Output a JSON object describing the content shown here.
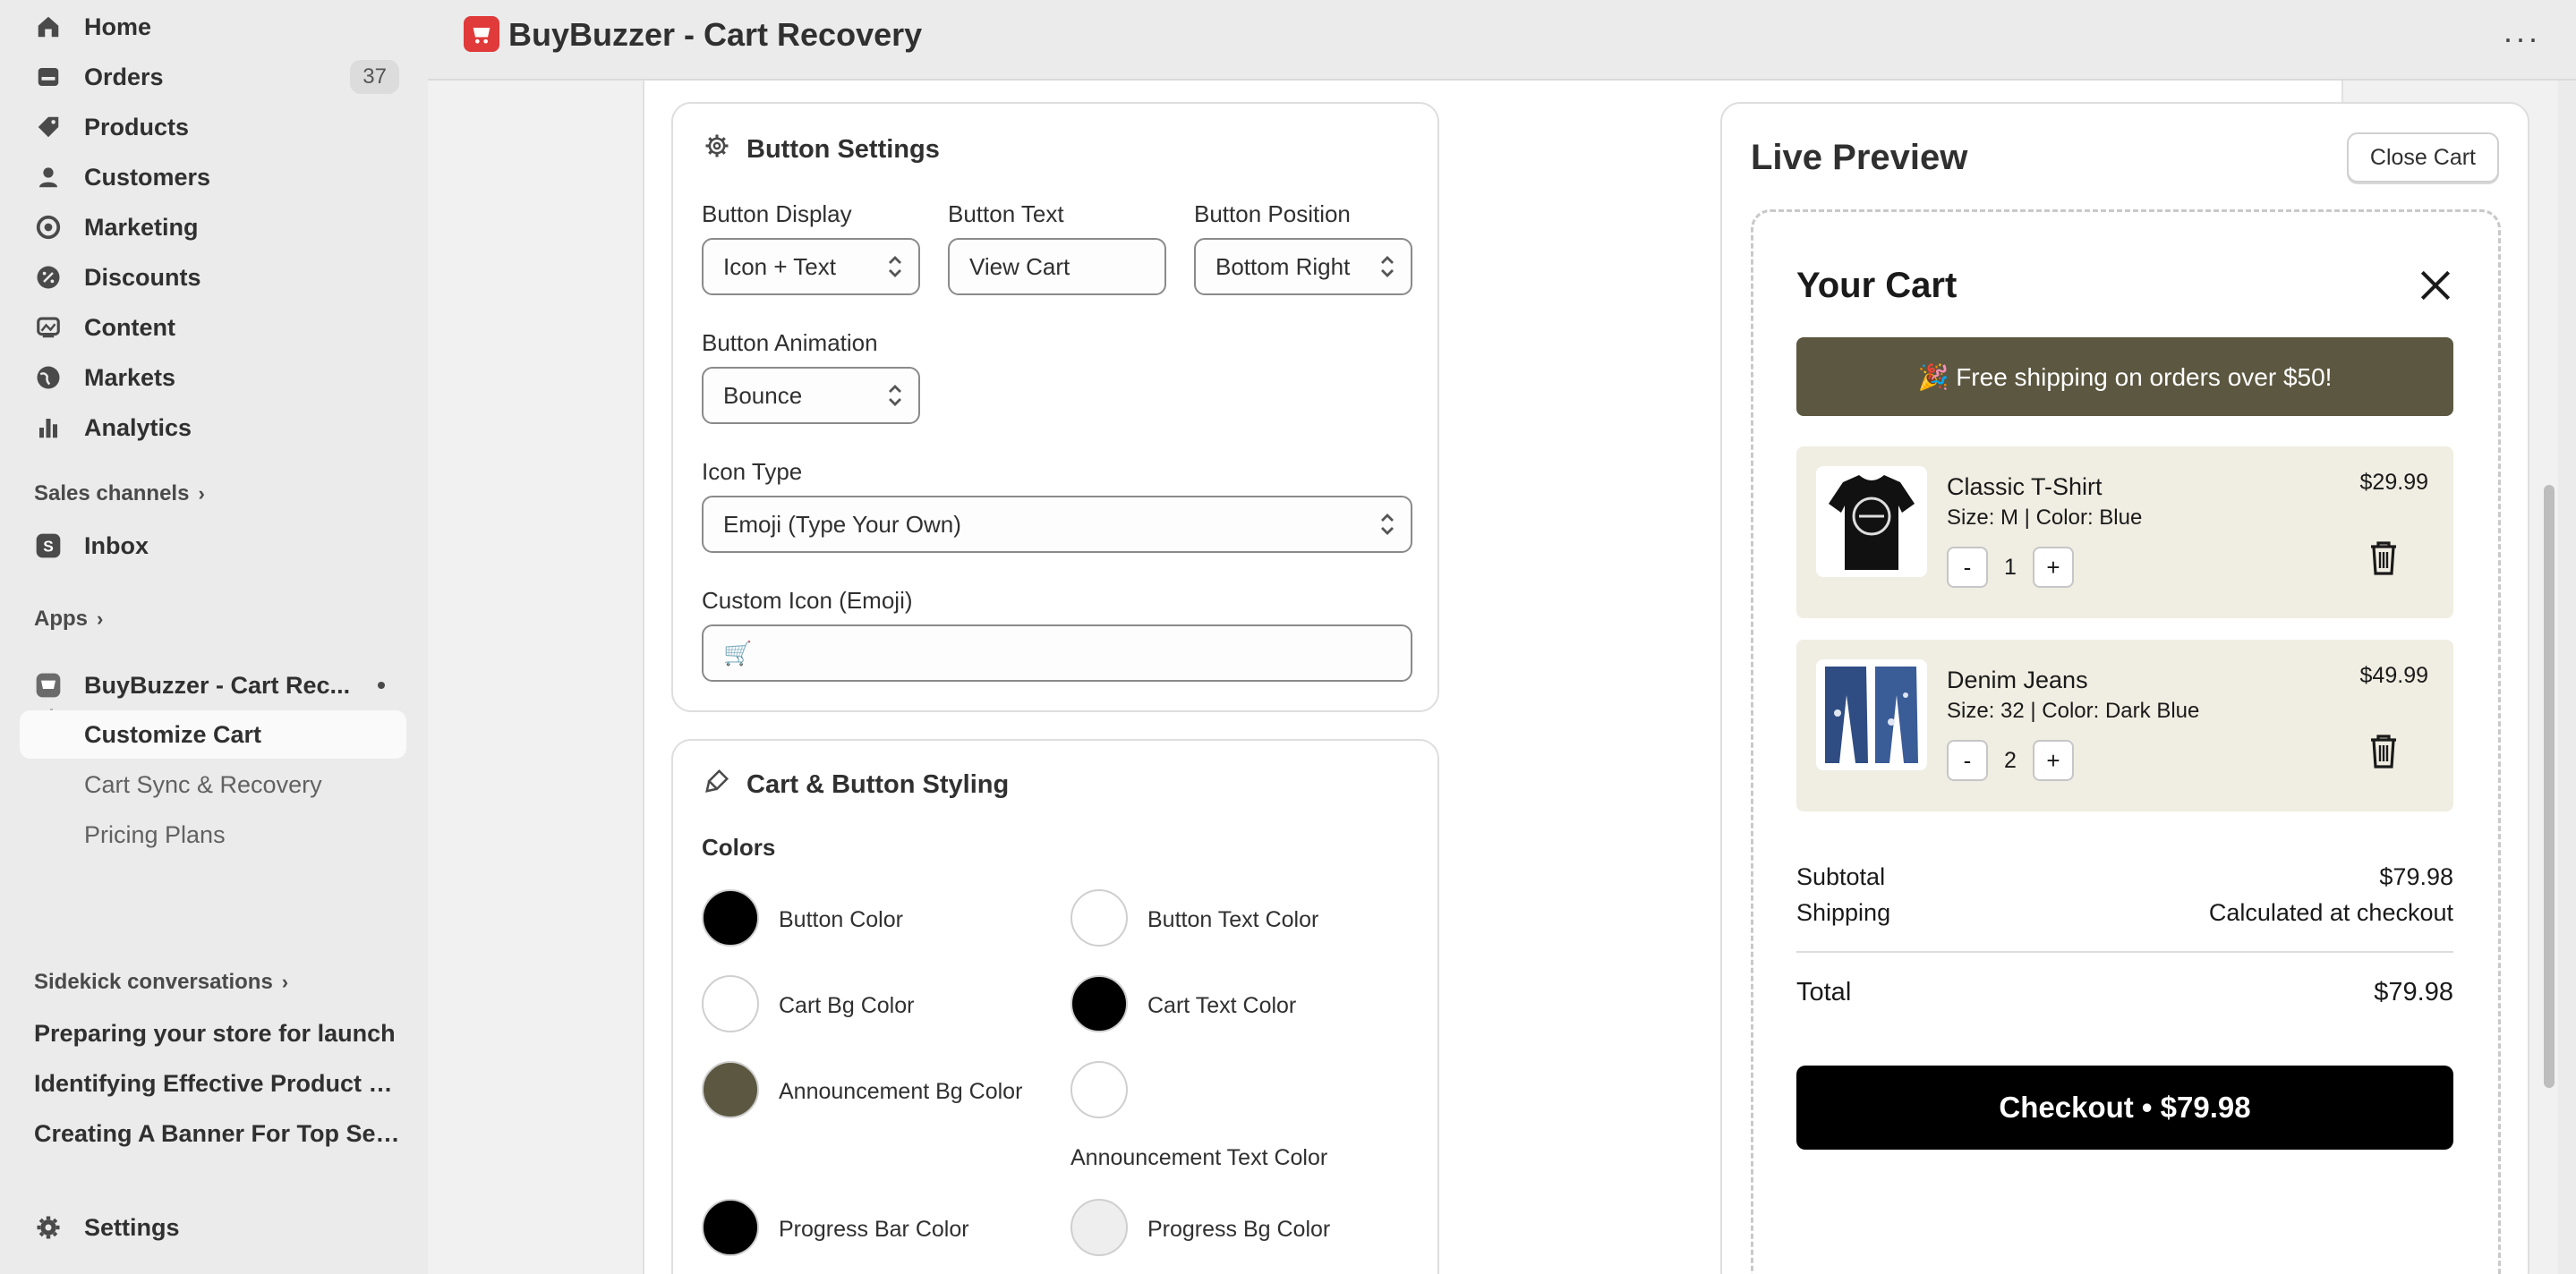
{
  "sidebar": {
    "nav": [
      {
        "label": "Home",
        "icon": "home-icon"
      },
      {
        "label": "Orders",
        "icon": "orders-icon",
        "badge": "37"
      },
      {
        "label": "Products",
        "icon": "tag-icon"
      },
      {
        "label": "Customers",
        "icon": "person-icon"
      },
      {
        "label": "Marketing",
        "icon": "target-icon"
      },
      {
        "label": "Discounts",
        "icon": "discount-icon"
      },
      {
        "label": "Content",
        "icon": "content-icon"
      },
      {
        "label": "Markets",
        "icon": "globe-icon"
      },
      {
        "label": "Analytics",
        "icon": "chart-icon"
      }
    ],
    "sales_channels": "Sales channels",
    "inbox": "Inbox",
    "apps": "Apps",
    "app_name": "BuyBuzzer - Cart Rec...",
    "sub_items": [
      "Customize Cart",
      "Cart Sync & Recovery",
      "Pricing Plans"
    ],
    "sidekick": "Sidekick conversations",
    "conversations": [
      "Preparing your store for launch",
      "Identifying Effective Product B...",
      "Creating A Banner For Top Sell..."
    ],
    "settings": "Settings"
  },
  "topbar": {
    "title": "BuyBuzzer - Cart Recovery",
    "more": "···"
  },
  "button_settings": {
    "title": "Button Settings",
    "display_label": "Button Display",
    "display_value": "Icon + Text",
    "text_label": "Button Text",
    "text_value": "View Cart",
    "position_label": "Button Position",
    "position_value": "Bottom Right",
    "animation_label": "Button Animation",
    "animation_value": "Bounce",
    "icon_type_label": "Icon Type",
    "icon_type_value": "Emoji (Type Your Own)",
    "custom_icon_label": "Custom Icon (Emoji)",
    "custom_icon_value": "🛒"
  },
  "styling": {
    "title": "Cart & Button Styling",
    "colors_label": "Colors",
    "colors": [
      {
        "label": "Button Color",
        "color": "#000000"
      },
      {
        "label": "Button Text Color",
        "color": "#ffffff"
      },
      {
        "label": "Cart Bg Color",
        "color": "#ffffff"
      },
      {
        "label": "Cart Text Color",
        "color": "#000000"
      },
      {
        "label": "Announcement Bg Color",
        "color": "#5c5740"
      },
      {
        "label": "Announcement Text Color",
        "color": "#ffffff"
      },
      {
        "label": "Progress Bar Color",
        "color": "#000000"
      },
      {
        "label": "Progress Bg Color",
        "color": "#eeeeee"
      }
    ]
  },
  "preview": {
    "title": "Live Preview",
    "close_button": "Close Cart",
    "cart_title": "Your Cart",
    "announcement": "🎉 Free shipping on orders over $50!",
    "items": [
      {
        "name": "Classic T-Shirt",
        "meta": "Size: M | Color: Blue",
        "price": "$29.99",
        "qty": "1"
      },
      {
        "name": "Denim Jeans",
        "meta": "Size: 32 | Color: Dark Blue",
        "price": "$49.99",
        "qty": "2"
      }
    ],
    "qty_minus": "-",
    "qty_plus": "+",
    "subtotal_label": "Subtotal",
    "subtotal_value": "$79.98",
    "shipping_label": "Shipping",
    "shipping_value": "Calculated at checkout",
    "total_label": "Total",
    "total_value": "$79.98",
    "checkout": "Checkout • $79.98"
  }
}
